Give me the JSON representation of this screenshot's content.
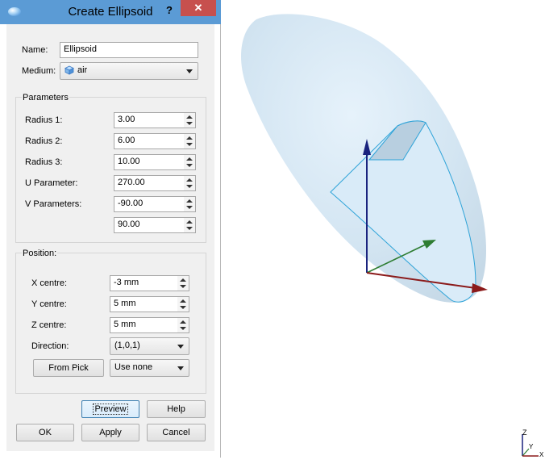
{
  "dialog": {
    "title": "Create Ellipsoid",
    "help_glyph": "?",
    "close_glyph": "✕"
  },
  "name": {
    "label": "Name:",
    "value": "Ellipsoid"
  },
  "medium": {
    "label": "Medium:",
    "value": "air"
  },
  "parameters": {
    "title": "Parameters",
    "radius1": {
      "label": "Radius 1:",
      "value": "3.00"
    },
    "radius2": {
      "label": "Radius 2:",
      "value": "6.00"
    },
    "radius3": {
      "label": "Radius 3:",
      "value": "10.00"
    },
    "u": {
      "label": "U Parameter:",
      "value": "270.00"
    },
    "v": {
      "label": "V Parameters:",
      "value_min": "-90.00",
      "value_max": "90.00"
    }
  },
  "position": {
    "title": "Position:",
    "x": {
      "label": "X centre:",
      "value": "-3 mm"
    },
    "y": {
      "label": "Y centre:",
      "value": "5 mm"
    },
    "z": {
      "label": "Z centre:",
      "value": "5 mm"
    },
    "direction": {
      "label": "Direction:",
      "value": "(1,0,1)"
    },
    "from_pick": "From Pick",
    "use": "Use none"
  },
  "buttons": {
    "preview": "Preview",
    "help": "Help",
    "ok": "OK",
    "apply": "Apply",
    "cancel": "Cancel"
  },
  "axes_indicator": {
    "z": "Z",
    "y": "Y",
    "x": "X"
  },
  "colors": {
    "titlebar": "#5b9bd5",
    "close": "#c7504e",
    "ellipsoid_fill": "#d6e8f5",
    "ellipsoid_edge": "#2ea3d8",
    "axis_x": "#8b1a1a",
    "axis_y": "#2e7d32",
    "axis_z": "#1a237e"
  }
}
